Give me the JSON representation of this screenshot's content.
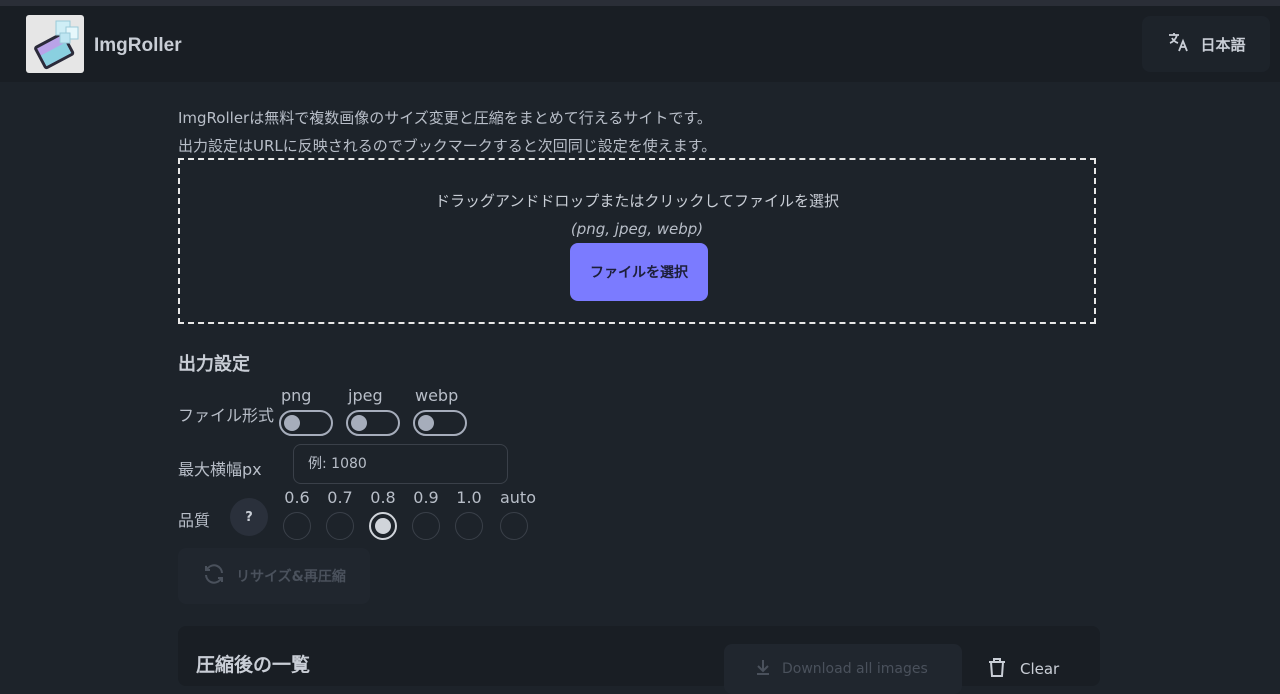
{
  "header": {
    "app_name": "ImgRoller",
    "language_label": "日本語",
    "logo_icon": "app-logo-icon",
    "language_icon": "translate-icon"
  },
  "intro": {
    "line1": "ImgRollerは無料で複数画像のサイズ変更と圧縮をまとめて行えるサイトです。",
    "line2": "出力設定はURLに反映されるのでブックマークすると次回同じ設定を使えます。"
  },
  "dropzone": {
    "instruction": "ドラッグアンドドロップまたはクリックしてファイルを選択",
    "formats": "(png, jpeg, webp)",
    "select_button": "ファイルを選択"
  },
  "settings": {
    "title": "出力設定",
    "file_format_label": "ファイル形式",
    "formats": [
      {
        "name": "png",
        "enabled": false
      },
      {
        "name": "jpeg",
        "enabled": false
      },
      {
        "name": "webp",
        "enabled": false
      }
    ],
    "max_width_label": "最大横幅px",
    "max_width_placeholder": "例: 1080",
    "max_width_value": "",
    "quality_label": "品質",
    "quality_help": "?",
    "quality_options": [
      "0.6",
      "0.7",
      "0.8",
      "0.9",
      "1.0",
      "auto"
    ],
    "quality_selected": "0.8",
    "resize_button": "リサイズ&再圧縮"
  },
  "results": {
    "title": "圧縮後の一覧",
    "download_all_label": "Download all images",
    "clear_label": "Clear"
  }
}
